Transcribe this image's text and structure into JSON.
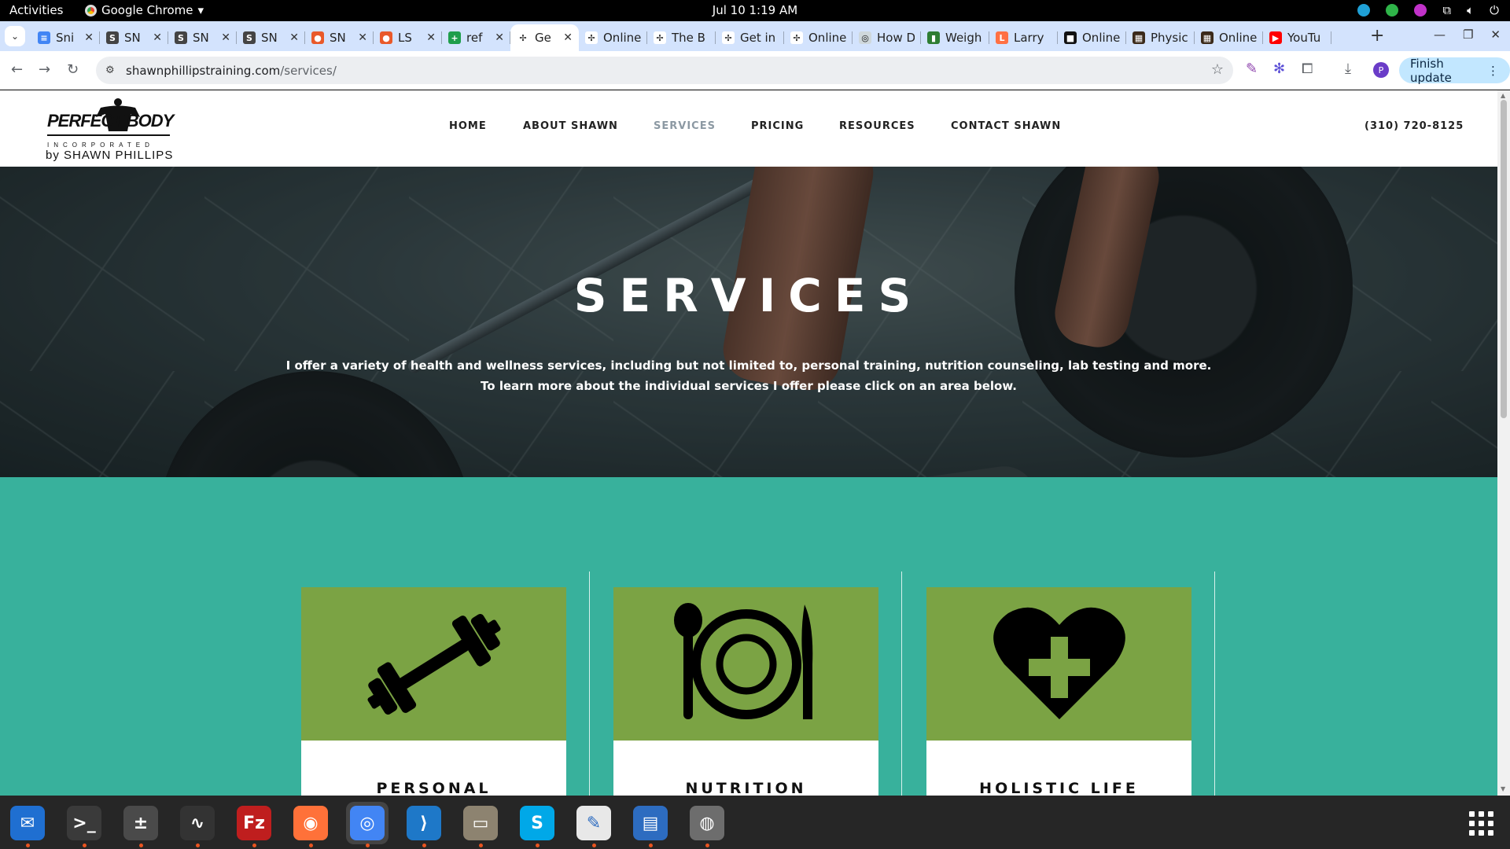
{
  "topbar": {
    "activities": "Activities",
    "app_name": "Google Chrome",
    "clock": "Jul 10  1:19 AM"
  },
  "tabs": [
    {
      "title": "Sni",
      "favicon_color": "#4285f4",
      "favicon_glyph": "≡"
    },
    {
      "title": "SN",
      "favicon_color": "#444444",
      "favicon_glyph": "S"
    },
    {
      "title": "SN",
      "favicon_color": "#444444",
      "favicon_glyph": "S"
    },
    {
      "title": "SN",
      "favicon_color": "#444444",
      "favicon_glyph": "S"
    },
    {
      "title": "SN",
      "favicon_color": "#e9592a",
      "favicon_glyph": "●"
    },
    {
      "title": "LS",
      "favicon_color": "#e9592a",
      "favicon_glyph": "●"
    },
    {
      "title": "ref",
      "favicon_color": "#1e9e4b",
      "favicon_glyph": "+"
    },
    {
      "title": "Ge",
      "favicon_color": "#ffffff",
      "favicon_glyph": "✢",
      "active": true
    },
    {
      "title": "Online",
      "favicon_color": "#ffffff",
      "favicon_glyph": "✢"
    },
    {
      "title": "The B",
      "favicon_color": "#ffffff",
      "favicon_glyph": "✢"
    },
    {
      "title": "Get in",
      "favicon_color": "#ffffff",
      "favicon_glyph": "✢"
    },
    {
      "title": "Online",
      "favicon_color": "#ffffff",
      "favicon_glyph": "✢"
    },
    {
      "title": "How D",
      "favicon_color": "#cfd8dc",
      "favicon_glyph": "◎"
    },
    {
      "title": "Weigh",
      "favicon_color": "#2e7d32",
      "favicon_glyph": "▮"
    },
    {
      "title": "Larry",
      "favicon_color": "#ff7043",
      "favicon_glyph": "L"
    },
    {
      "title": "Online",
      "favicon_color": "#111111",
      "favicon_glyph": "■"
    },
    {
      "title": "Physic",
      "favicon_color": "#3b2a1a",
      "favicon_glyph": "▦"
    },
    {
      "title": "Online",
      "favicon_color": "#3b2a1a",
      "favicon_glyph": "▦"
    },
    {
      "title": "YouTu",
      "favicon_color": "#ff0000",
      "favicon_glyph": "▶"
    }
  ],
  "toolbar": {
    "url_host": "shawnphillipstraining.com",
    "url_path": "/services/",
    "profile_initial": "P",
    "finish_update": "Finish update"
  },
  "site": {
    "logo_main": "PERFECT BODY",
    "logo_inc": "INCORPORATED",
    "logo_by": "by SHAWN PHILLIPS",
    "nav": [
      "HOME",
      "ABOUT SHAWN",
      "SERVICES",
      "PRICING",
      "RESOURCES",
      "CONTACT SHAWN"
    ],
    "current_nav": "SERVICES",
    "phone": "(310) 720-8125"
  },
  "hero": {
    "title": "SERVICES",
    "intro": "I offer a variety of health and wellness services, including but not limited to, personal training, nutrition counseling, lab testing and more. To learn more about the individual services I offer please click on an area below."
  },
  "services": [
    {
      "label": "PERSONAL",
      "icon": "dumbbell-icon"
    },
    {
      "label": "NUTRITION",
      "icon": "plate-utensils-icon"
    },
    {
      "label": "HOLISTIC LIFE",
      "icon": "heart-plus-icon"
    }
  ],
  "colors": {
    "section_bg": "#38b19c",
    "card_icon_bg": "#7ba344",
    "nav_current": "#8c99a3"
  },
  "dock": [
    {
      "name": "thunderbird",
      "color": "#1f6fd1",
      "glyph": "✉"
    },
    {
      "name": "terminal",
      "color": "#3a3a3a",
      "glyph": ">_"
    },
    {
      "name": "calculator",
      "color": "#4a4a4a",
      "glyph": "±"
    },
    {
      "name": "system-monitor",
      "color": "#333333",
      "glyph": "∿"
    },
    {
      "name": "filezilla",
      "color": "#bf1e1e",
      "glyph": "Fz"
    },
    {
      "name": "firefox",
      "color": "#ff7139",
      "glyph": "◉"
    },
    {
      "name": "chrome",
      "color": "#4285f4",
      "glyph": "◎"
    },
    {
      "name": "vscode",
      "color": "#1e78c8",
      "glyph": "⟩"
    },
    {
      "name": "files",
      "color": "#8d8370",
      "glyph": "▭"
    },
    {
      "name": "skype",
      "color": "#00a8e8",
      "glyph": "S"
    },
    {
      "name": "text-editor",
      "color": "#e8e8e8",
      "glyph": "✎"
    },
    {
      "name": "document-viewer",
      "color": "#2d6cc0",
      "glyph": "▤"
    },
    {
      "name": "disks",
      "color": "#6d6d6d",
      "glyph": "◍"
    }
  ]
}
